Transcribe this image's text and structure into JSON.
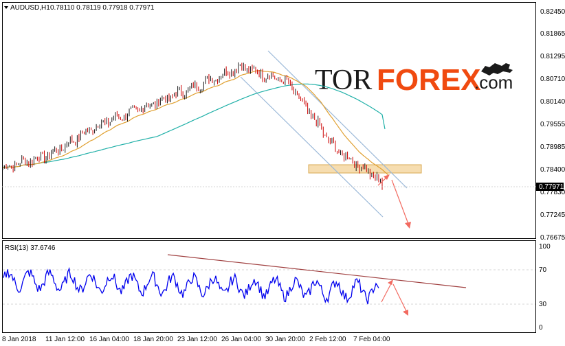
{
  "header": {
    "symbol": "AUDUSD,H1",
    "ohlc": "0.78110 0.78119 0.77918 0.77971"
  },
  "price_axis": {
    "labels": [
      "0.82450",
      "0.81865",
      "0.81295",
      "0.80710",
      "0.80140",
      "0.79555",
      "0.78985",
      "0.78400",
      "0.77830",
      "0.77245",
      "0.76675"
    ],
    "current_price": "0.77971"
  },
  "rsi": {
    "header": "RSI(13) 37.6746",
    "labels": [
      "100",
      "70",
      "30",
      "0"
    ]
  },
  "time_axis": {
    "labels": [
      "8 Jan 2018",
      "11 Jan 12:00",
      "16 Jan 04:00",
      "18 Jan 20:00",
      "23 Jan 12:00",
      "26 Jan 04:00",
      "30 Jan 20:00",
      "2 Feb 12:00",
      "7 Feb 04:00"
    ]
  },
  "watermark": {
    "tor": "TOR",
    "forex": "FOREX",
    "com": ".com"
  },
  "colors": {
    "candle_up": "#1a1a1a",
    "candle_down": "#cc0000",
    "ma_fast": "#e0a030",
    "ma_slow": "#20b0a8",
    "channel": "#9ab8d8",
    "rsi_line": "#0000ee",
    "trend_line": "#a04040",
    "arrows": "#f26a60",
    "zone": "#f6ddb0"
  },
  "chart_data": {
    "type": "candlestick",
    "title": "AUDUSD,H1",
    "ylim": [
      0.76675,
      0.8245
    ],
    "price_path": [
      {
        "x": "8 Jan 2018",
        "y": 0.7845
      },
      {
        "x": "11 Jan 12:00",
        "y": 0.788
      },
      {
        "x": "16 Jan 04:00",
        "y": 0.7955
      },
      {
        "x": "18 Jan 20:00",
        "y": 0.8002
      },
      {
        "x": "23 Jan 12:00",
        "y": 0.805
      },
      {
        "x": "26 Jan 04:00",
        "y": 0.8105
      },
      {
        "x": "30 Jan 20:00",
        "y": 0.8065
      },
      {
        "x": "2 Feb 12:00",
        "y": 0.7895
      },
      {
        "x": "7 Feb 04:00",
        "y": 0.781
      }
    ],
    "last_close": 0.77971,
    "rsi_period": 13,
    "rsi_last": 37.6746,
    "rsi_levels": [
      70,
      30
    ],
    "rsi_ylim": [
      0,
      100
    ]
  }
}
